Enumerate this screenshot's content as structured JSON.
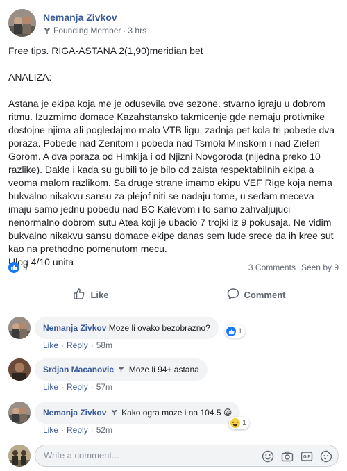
{
  "post": {
    "author": "Nemanja Zivkov",
    "badge": "Founding Member",
    "separator": "·",
    "time": "3 hrs",
    "lines": [
      "Free tips. RIGA-ASTANA 2(1,90)meridian bet",
      "ANALIZA:",
      "Astana je ekipa koja me je odusevila ove sezone. stvarno igraju u dobrom ritmu. Izuzmimo domace Kazahstansko takmicenje gde nemaju protivnike dostojne njima ali pogledajmo malo VTB ligu, zadnja pet kola tri pobede dva poraza. Pobede nad Zenitom i pobeda nad Tsmoki Minskom i nad Zielen Gorom. A dva poraza od Himkija i od Njizni Novgoroda (nijedna preko 10 razlike). Dakle i kada su gubili to je bilo od zaista respektabilnih ekipa a veoma malom razlikom. Sa druge strane imamo ekipu VEF Rige koja nema bukvalno nikakvu sansu za plejof niti se nadaju tome, u sedam meceva imaju samo jednu pobedu nad BC Kalevom i to samo zahvaljujuci nenormalno dobrom sutu Atea koji je ubacio 7 trojki iz 9 pokusaja. Ne vidim bukvalno nikakvu sansu domace ekipe danas sem lude srece da ih kree sut kao na prethodno pomenutom mecu.\nUlog 4/10 unita"
    ]
  },
  "stats": {
    "likes": "9",
    "comments": "3 Comments",
    "seen": "Seen by 9"
  },
  "actions": {
    "like": "Like",
    "comment": "Comment"
  },
  "comments": [
    {
      "name": "Nemanja Zivkov",
      "text": "Moze li ovako bezobrazno?",
      "like": "Like",
      "reply": "Reply",
      "time": "58m",
      "reaction_count": "1",
      "reaction": "like"
    },
    {
      "name": "Srdjan Macanovic",
      "text": "Moze li 94+ astana",
      "like": "Like",
      "reply": "Reply",
      "time": "57m"
    },
    {
      "name": "Nemanja Zivkov",
      "text": "Kako ogra moze i na 104.5",
      "emoji": "😁",
      "like": "Like",
      "reply": "Reply",
      "time": "52m",
      "reaction_count": "1",
      "reaction": "haha"
    }
  ],
  "comment_actions_separator": "·",
  "write": {
    "placeholder": "Write a comment..."
  },
  "colors": {
    "link": "#385898",
    "like_blue": "#1877f2",
    "muted": "#616770",
    "bubble_bg": "#f2f3f5",
    "haha_yellow": "#f7d14a"
  }
}
